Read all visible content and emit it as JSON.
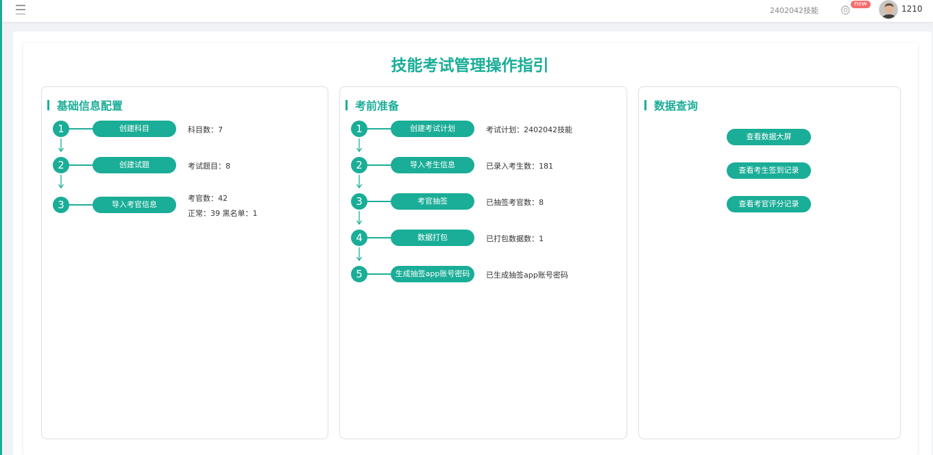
{
  "header": {
    "exam_name": "2402042技能",
    "badge": "new",
    "user_id": "1210"
  },
  "page": {
    "title": "技能考试管理操作指引"
  },
  "panels": {
    "basic": {
      "title": "基础信息配置",
      "steps": [
        {
          "num": "1",
          "label": "创建科目",
          "info": "科目数：7"
        },
        {
          "num": "2",
          "label": "创建试题",
          "info": "考试题目：8"
        },
        {
          "num": "3",
          "label": "导入考官信息",
          "info": "考官数：42",
          "info2": "正常：39  黑名单：1"
        }
      ]
    },
    "prep": {
      "title": "考前准备",
      "steps": [
        {
          "num": "1",
          "label": "创建考试计划",
          "info": "考试计划：2402042技能"
        },
        {
          "num": "2",
          "label": "导入考生信息",
          "info": "已录入考生数：181"
        },
        {
          "num": "3",
          "label": "考官抽签",
          "info": "已抽签考官数：8"
        },
        {
          "num": "4",
          "label": "数据打包",
          "info": "已打包数据数：1"
        },
        {
          "num": "5",
          "label": "生成抽签app账号密码",
          "info": "已生成抽签app账号密码"
        }
      ]
    },
    "query": {
      "title": "数据查询",
      "buttons": [
        "查看数据大屏",
        "查看考生签到记录",
        "查看考官评分记录"
      ]
    }
  },
  "colors": {
    "accent": "#1aad97",
    "badge": "#f56c6c"
  }
}
